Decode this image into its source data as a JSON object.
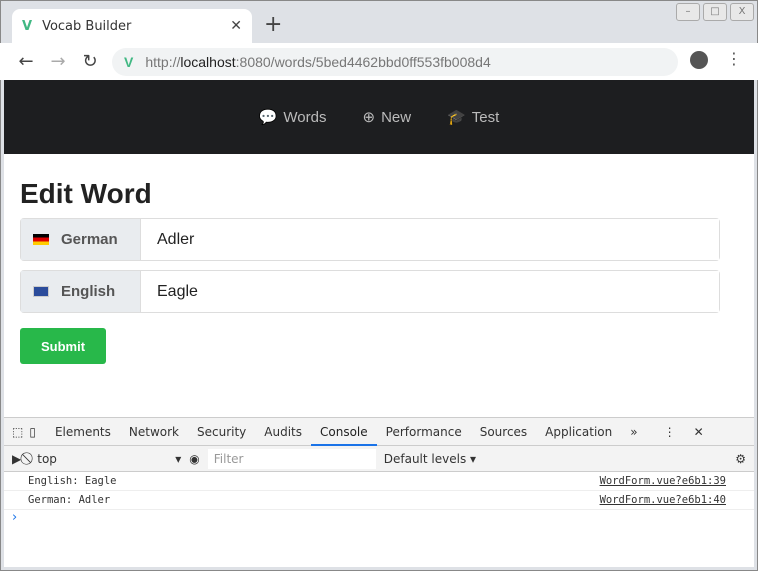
{
  "browser": {
    "tab_title": "Vocab Builder",
    "url_prefix": "http://",
    "url_host": "localhost",
    "url_rest": ":8080/words/5bed4462bbd0ff553fb008d4"
  },
  "navbar": {
    "items": [
      {
        "icon": "comment-icon",
        "label": "Words"
      },
      {
        "icon": "plus-circle-icon",
        "label": "New"
      },
      {
        "icon": "graduation-cap-icon",
        "label": "Test"
      }
    ]
  },
  "form": {
    "title": "Edit Word",
    "german_label": "German",
    "german_value": "Adler",
    "english_label": "English",
    "english_value": "Eagle",
    "submit_label": "Submit"
  },
  "devtools": {
    "tabs": [
      "Elements",
      "Network",
      "Security",
      "Audits",
      "Console",
      "Performance",
      "Sources",
      "Application"
    ],
    "active_tab": "Console",
    "context": "top",
    "filter_placeholder": "Filter",
    "levels": "Default levels ▾",
    "logs": [
      {
        "message": "English: Eagle",
        "source": "WordForm.vue?e6b1:39"
      },
      {
        "message": "German: Adler",
        "source": "WordForm.vue?e6b1:40"
      }
    ]
  }
}
